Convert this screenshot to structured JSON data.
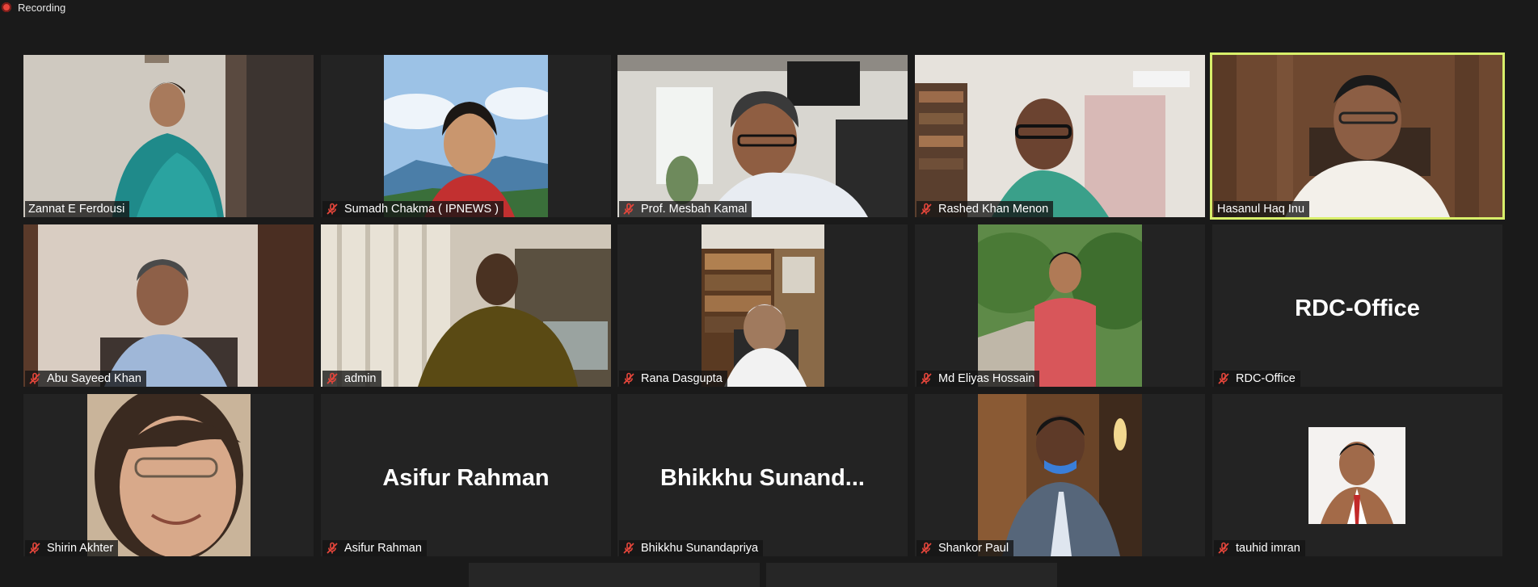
{
  "recording": {
    "label": "Recording"
  },
  "tiles": [
    {
      "name": "Zannat E Ferdousi",
      "muted": false
    },
    {
      "name": "Sumadh Chakma ( IPNEWS )",
      "muted": true
    },
    {
      "name": "Prof. Mesbah Kamal",
      "muted": true
    },
    {
      "name": "Rashed Khan Menon",
      "muted": true
    },
    {
      "name": "Hasanul Haq Inu",
      "muted": false,
      "active_speaker": true
    },
    {
      "name": "Abu Sayeed Khan",
      "muted": true
    },
    {
      "name": "admin",
      "muted": true
    },
    {
      "name": "Rana Dasgupta",
      "muted": true
    },
    {
      "name": "Md Eliyas Hossain",
      "muted": true
    },
    {
      "name": "RDC-Office",
      "muted": true,
      "center_text": "RDC-Office"
    },
    {
      "name": "Shirin Akhter",
      "muted": true
    },
    {
      "name": "Asifur Rahman",
      "muted": true,
      "center_text": "Asifur Rahman"
    },
    {
      "name": "Bhikkhu Sunandapriya",
      "muted": true,
      "center_text": "Bhikkhu  Sunand..."
    },
    {
      "name": "Shankor Paul",
      "muted": true
    },
    {
      "name": "tauhid imran",
      "muted": true
    }
  ],
  "colors": {
    "active_border": "#d8ef6a",
    "mute_red": "#e5463b",
    "background": "#1a1a1a"
  }
}
